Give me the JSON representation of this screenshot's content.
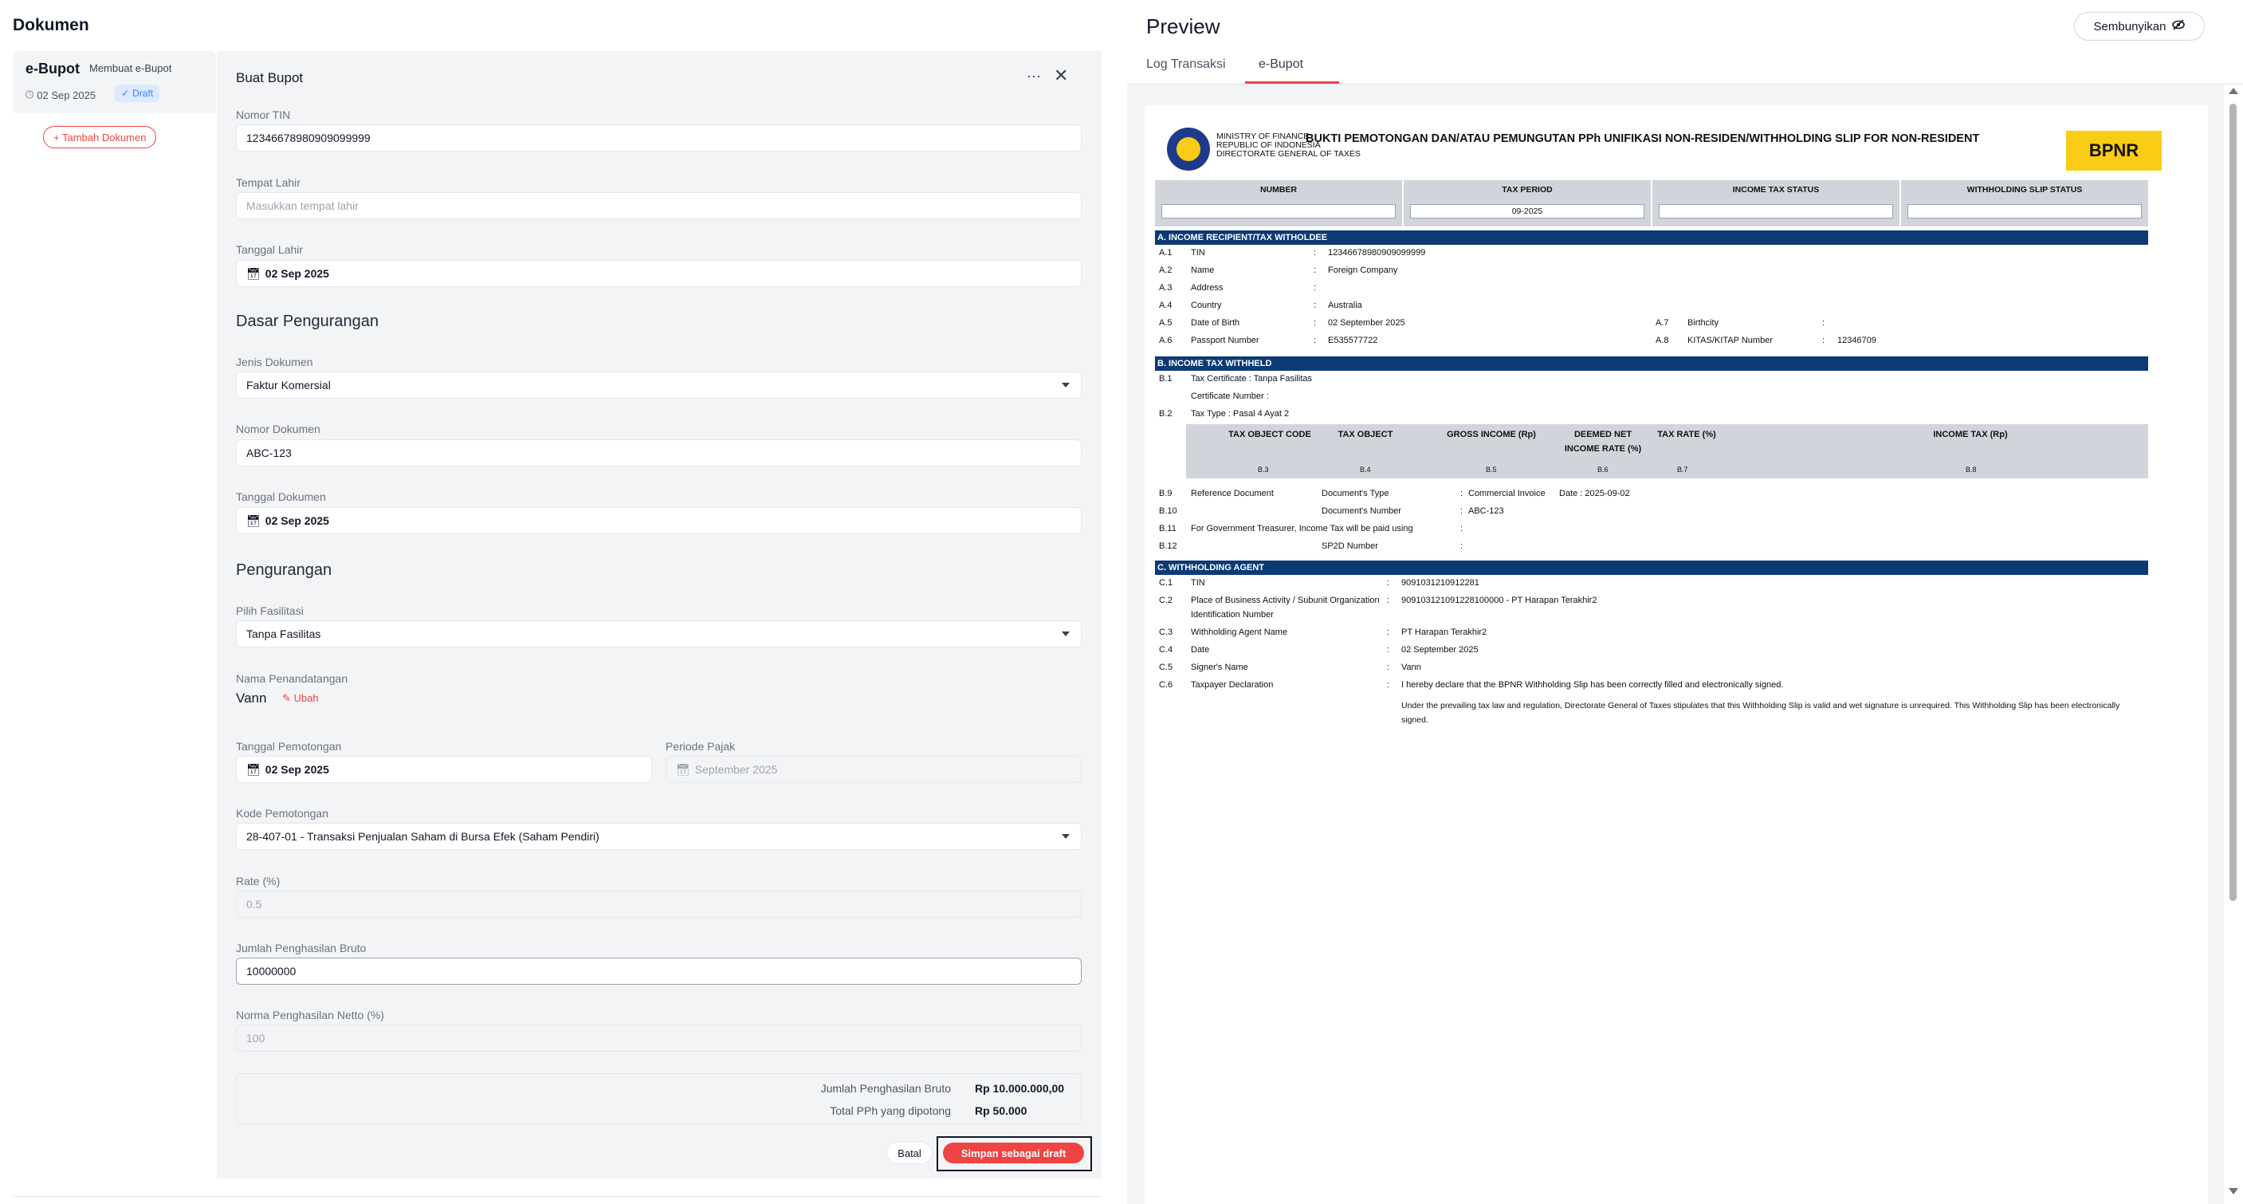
{
  "left": {
    "title": "Dokumen",
    "doc_card": {
      "name": "e-Bupot",
      "subtitle": "Membuat e-Bupot",
      "date": "02 Sep 2025",
      "status": "Draft"
    },
    "add_doc_label": "+ Tambah Dokumen"
  },
  "form": {
    "title": "Buat Bupot",
    "more_icon": "⋯",
    "close_icon": "✕",
    "nomor_tin": {
      "label": "Nomor TIN",
      "value": "12346678980909099999"
    },
    "tempat_lahir": {
      "label": "Tempat Lahir",
      "placeholder": "Masukkan tempat lahir"
    },
    "tanggal_lahir": {
      "label": "Tanggal Lahir",
      "value": "02 Sep 2025"
    },
    "section_dasar": "Dasar Pengurangan",
    "jenis_dokumen": {
      "label": "Jenis Dokumen",
      "value": "Faktur Komersial"
    },
    "nomor_dokumen": {
      "label": "Nomor Dokumen",
      "value": "ABC-123"
    },
    "tanggal_dokumen": {
      "label": "Tanggal Dokumen",
      "value": "02 Sep 2025"
    },
    "section_pengurangan": "Pengurangan",
    "fasilitas": {
      "label": "Pilih Fasilitasi",
      "value": "Tanpa Fasilitas"
    },
    "penandatangan": {
      "label": "Nama Penandatangan",
      "value": "Vann",
      "edit_label": "Ubah"
    },
    "tanggal_pemotongan": {
      "label": "Tanggal Pemotongan",
      "value": "02 Sep 2025"
    },
    "periode_pajak": {
      "label": "Periode Pajak",
      "value": "September 2025"
    },
    "kode_pemotongan": {
      "label": "Kode Pemotongan",
      "value": "28-407-01 - Transaksi Penjualan Saham di Bursa Efek (Saham Pendiri)"
    },
    "rate": {
      "label": "Rate (%)",
      "value": "0.5"
    },
    "penghasilan_bruto": {
      "label": "Jumlah Penghasilan Bruto",
      "value": "10000000"
    },
    "norma": {
      "label": "Norma Penghasilan Netto (%)",
      "value": "100"
    },
    "summary": {
      "bruto_label": "Jumlah Penghasilan Bruto",
      "bruto_value": "Rp 10.000.000,00",
      "pph_label": "Total PPh yang dipotong",
      "pph_value": "Rp 50.000"
    },
    "cancel_label": "Batal",
    "save_label": "Simpan sebagai draft"
  },
  "preview": {
    "title": "Preview",
    "hide_label": "Sembunyikan",
    "tabs": [
      {
        "label": "Log Transaksi"
      },
      {
        "label": "e-Bupot"
      }
    ],
    "paper": {
      "ministry": [
        "MINISTRY OF FINANCE",
        "REPUBLIC OF INDONESIA",
        "DIRECTORATE GENERAL OF TAXES"
      ],
      "heading": "BUKTI PEMOTONGAN DAN/ATAU PEMUNGUTAN PPh UNIFIKASI NON-RESIDEN/WITHHOLDING SLIP FOR NON-RESIDENT",
      "badge": "BPNR",
      "header_cols": [
        {
          "label": "NUMBER",
          "value": ""
        },
        {
          "label": "TAX PERIOD",
          "value": "09-2025"
        },
        {
          "label": "INCOME TAX STATUS",
          "value": ""
        },
        {
          "label": "WITHHOLDING SLIP STATUS",
          "value": ""
        }
      ],
      "section_a": "A. INCOME RECIPIENT/TAX WITHOLDEE",
      "a_rows": [
        {
          "no": "A.1",
          "label": "TIN",
          "value": "12346678980909099999"
        },
        {
          "no": "A.2",
          "label": "Name",
          "value": "Foreign Company"
        },
        {
          "no": "A.3",
          "label": "Address",
          "value": ""
        },
        {
          "no": "A.4",
          "label": "Country",
          "value": "Australia"
        },
        {
          "no": "A.5",
          "label": "Date of Birth",
          "value": "02 September 2025"
        },
        {
          "no": "A.6",
          "label": "Passport Number",
          "value": "E535577722"
        }
      ],
      "a_right": [
        {
          "no": "A.7",
          "label": "Birthcity",
          "value": ""
        },
        {
          "no": "A.8",
          "label": "KITAS/KITAP Number",
          "value": "12346709"
        }
      ],
      "section_b": "B. INCOME TAX WITHHELD",
      "b1_no": "B.1",
      "b1_line1": "Tax Certificate : Tanpa Fasilitas",
      "b1_line2": "Certificate Number :",
      "b2_no": "B.2",
      "b2_line": "Tax Type : Pasal 4 Ayat 2",
      "b_cols": [
        {
          "label": "TAX OBJECT CODE",
          "no": "B.3"
        },
        {
          "label": "TAX OBJECT",
          "no": "B.4"
        },
        {
          "label": "GROSS INCOME (Rp)",
          "no": "B.5"
        },
        {
          "label": "DEEMED NET INCOME RATE (%)",
          "no": "B.6"
        },
        {
          "label": "TAX RATE (%)",
          "no": "B.7"
        },
        {
          "label": "INCOME TAX (Rp)",
          "no": "B.8"
        }
      ],
      "b_refs": {
        "b9_no": "B.9",
        "b9_label": "Reference Document",
        "b9_type_label": "Document's Type",
        "b9_type_value": "Commercial Invoice",
        "b9_date": "Date : 2025-09-02",
        "b10_no": "B.10",
        "b10_label": "Document's Number",
        "b10_value": "ABC-123",
        "b11_no": "B.11",
        "b11_label": "For Government Treasurer, Income Tax will be paid using",
        "b12_no": "B.12",
        "b12_label": "SP2D Number"
      },
      "section_c": "C. WITHHOLDING AGENT",
      "c_rows": [
        {
          "no": "C.1",
          "label": "TIN",
          "value": "9091031210912281"
        },
        {
          "no": "C.2",
          "label": "Place of Business Activity / Subunit Organization",
          "value": "909103121091228100000 - PT Harapan Terakhir2"
        },
        {
          "no": "C.3",
          "label": "Withholding Agent Name",
          "value": "PT Harapan Terakhir2"
        },
        {
          "no": "C.4",
          "label": "Date",
          "value": "02 September 2025"
        },
        {
          "no": "C.5",
          "label": "Signer's Name",
          "value": "Vann"
        },
        {
          "no": "C.6",
          "label": "Taxpayer Declaration",
          "value": "I hereby declare that the BPNR Withholding Slip has been correctly filled and electronically signed."
        }
      ],
      "c2_extra": "Identification Number",
      "c6_extra_1": "Under the prevailing tax law and regulation, Directorate General of Taxes stipulates that this Withholding Slip is valid and wet signature is unrequired. This Withholding Slip has been electronically",
      "c6_extra_2": "signed."
    }
  },
  "colors": {
    "accent": "#ef4444",
    "navy": "#0b3a75",
    "badge_yellow": "#facc15",
    "draft_blue": "#3b82f6"
  },
  "icons": [
    "clock-icon",
    "check-circle-icon",
    "calendar-icon",
    "chevron-down-icon",
    "pencil-icon",
    "more-icon",
    "close-icon",
    "eye-off-icon"
  ]
}
